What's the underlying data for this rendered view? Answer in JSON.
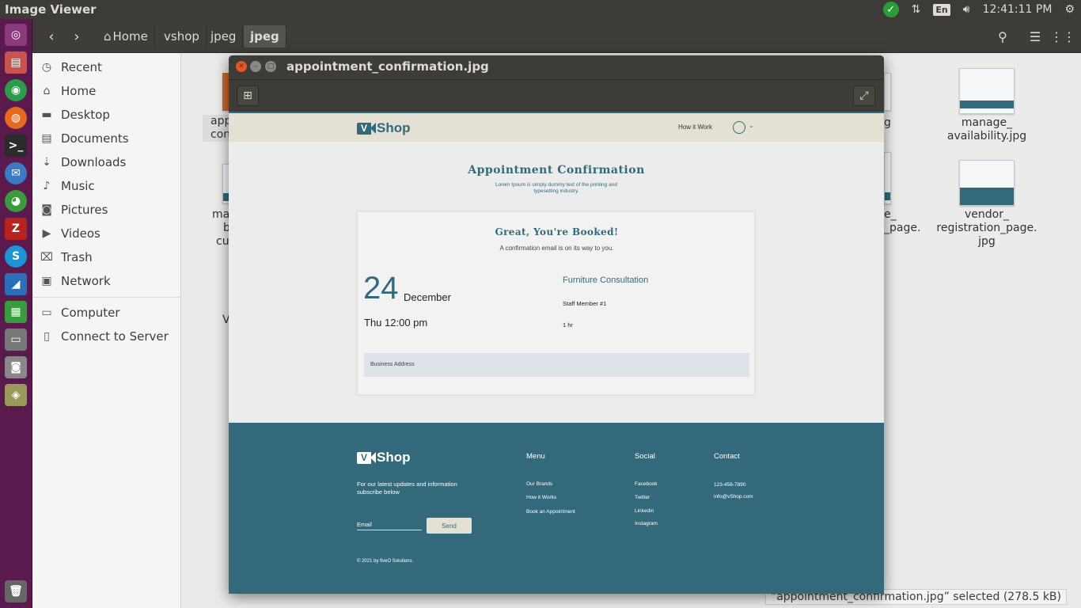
{
  "top_panel": {
    "app_title": "Image Viewer",
    "clock": "12:41:11 PM",
    "keyboard_layout": "En"
  },
  "launcher": {
    "items": [
      "ubuntu-dash",
      "files",
      "vpn",
      "firefox",
      "terminal",
      "thunderbird",
      "chrome",
      "filezilla",
      "skype",
      "vscode",
      "spreadsheet",
      "scanner",
      "screenshot",
      "image-viewer",
      "trash"
    ]
  },
  "header": {
    "breadcrumbs": [
      "Home",
      "vshop",
      "jpeg",
      "jpeg"
    ]
  },
  "sidebar": {
    "items": [
      {
        "label": "Recent",
        "icon": "clock-icon"
      },
      {
        "label": "Home",
        "icon": "home-icon"
      },
      {
        "label": "Desktop",
        "icon": "folder-icon"
      },
      {
        "label": "Documents",
        "icon": "document-icon"
      },
      {
        "label": "Downloads",
        "icon": "download-icon"
      },
      {
        "label": "Music",
        "icon": "music-icon"
      },
      {
        "label": "Pictures",
        "icon": "camera-icon"
      },
      {
        "label": "Videos",
        "icon": "video-icon"
      },
      {
        "label": "Trash",
        "icon": "trash-icon"
      },
      {
        "label": "Network",
        "icon": "network-icon"
      }
    ],
    "devices": [
      {
        "label": "Computer",
        "icon": "computer-icon"
      },
      {
        "label": "Connect to Server",
        "icon": "server-icon"
      }
    ]
  },
  "files": {
    "partial_left": [
      "app",
      "conf",
      "ma",
      "b",
      "cu",
      "V"
    ],
    "partial_right": [
      "g",
      "e_",
      "_page."
    ],
    "right_column": [
      {
        "line1": "manage_",
        "line2": "availability.jpg",
        "line3": ""
      },
      {
        "line1": "vendor_",
        "line2": "registration_page.",
        "line3": "jpg"
      }
    ]
  },
  "status": "“appointment_confirmation.jpg” selected  (278.5 kB)",
  "viewer": {
    "title": "appointment_confirmation.jpg",
    "image": {
      "logo_v": "V",
      "logo_shop": "Shop",
      "nav_link": "How it Work",
      "page_title": "Appointment Confirmation",
      "page_sub": "Lorem Ipsum is simply dummy text of the printing and typesetting industry.",
      "card_title": "Great, You're Booked!",
      "card_sub": "A conﬁrmation email is on its way to you.",
      "day": "24",
      "month": "December",
      "time": "Thu 12:00 pm",
      "service": "Furniture Consultation",
      "staff": "Staff Member #1",
      "duration": "1 hr",
      "address": "Business Address",
      "footer": {
        "newsletter": "For our latest updates and information subscribe below",
        "email_placeholder": "Email",
        "send": "Send",
        "copyright": "© 2021 by fiveO Solutions.",
        "menu_head": "Menu",
        "menu": [
          "Our Brands",
          "How it Works",
          "Book an Appointment"
        ],
        "social_head": "Social",
        "social": [
          "Facebook",
          "Twitter",
          "Linkedin",
          "Instagram"
        ],
        "contact_head": "Contact",
        "contact": [
          "123-456-7890",
          "info@vShop.com"
        ]
      }
    }
  },
  "colors": {
    "brand_teal": "#336a7b",
    "nav_beige": "#e4e0d3",
    "launcher": "#5a1a4d",
    "panel": "#3c3b37"
  }
}
